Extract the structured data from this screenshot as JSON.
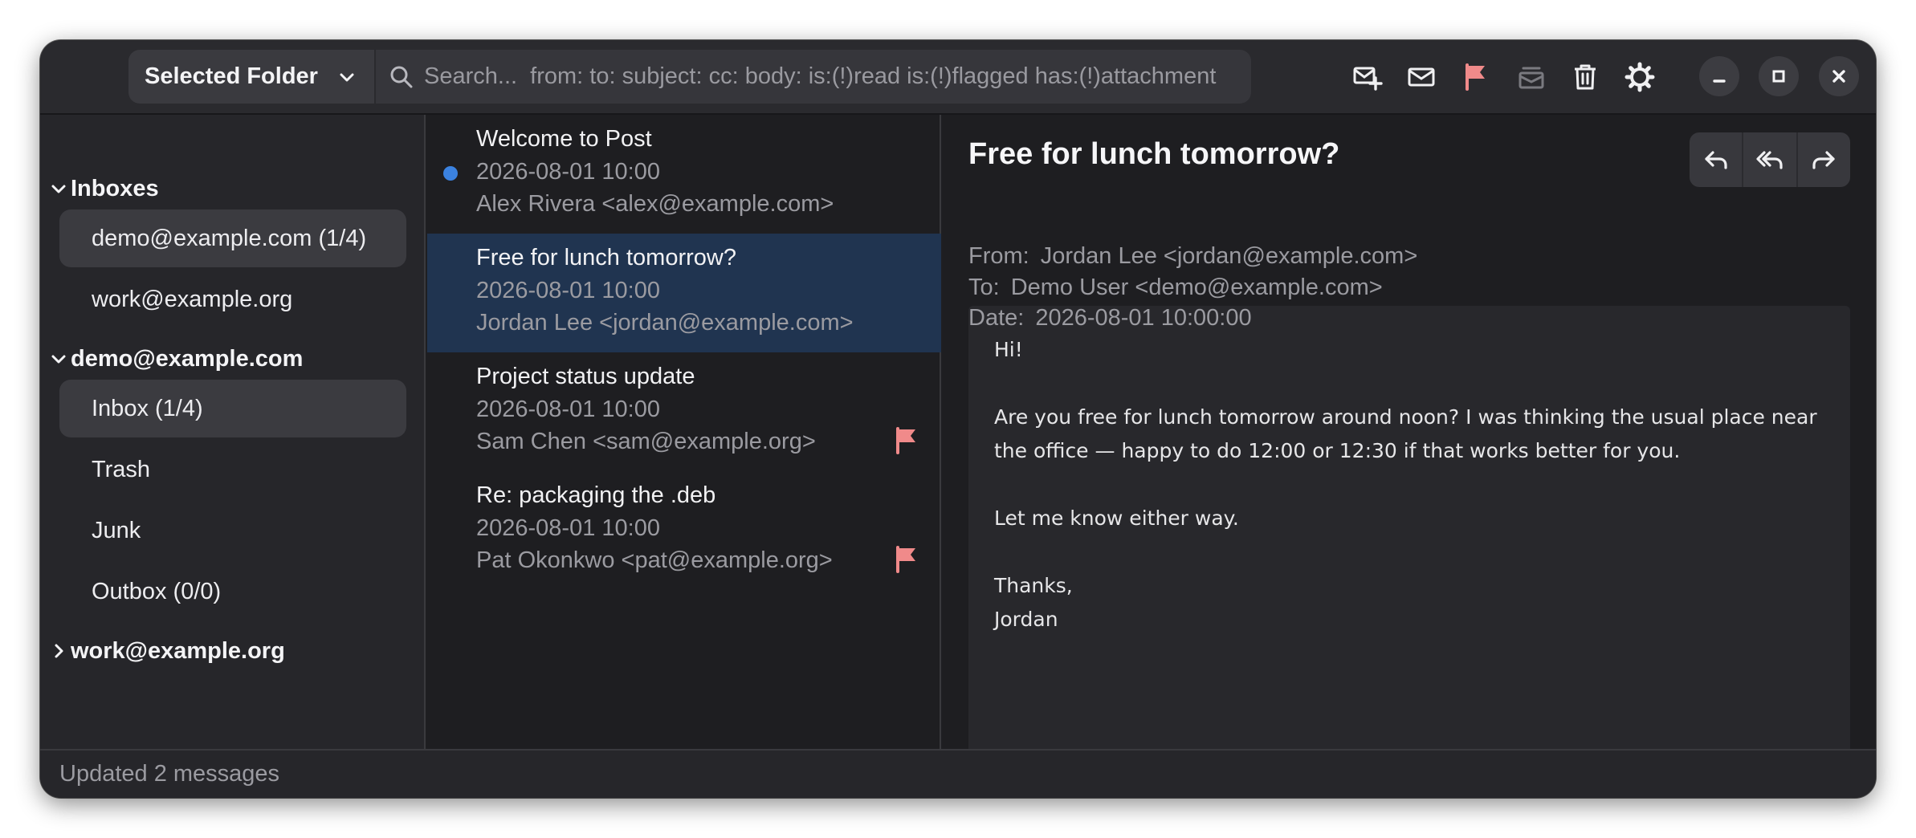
{
  "header": {
    "folder_select_label": "Selected Folder",
    "search_placeholder": "Search...  from: to: subject: cc: body: is:(!)read is:(!)flagged has:(!)attachment"
  },
  "sidebar": {
    "groups": [
      {
        "title": "Inboxes",
        "expanded": true,
        "items": [
          "demo@example.com (1/4)",
          "work@example.org"
        ]
      },
      {
        "title": "demo@example.com",
        "expanded": true,
        "items": [
          "Inbox (1/4)",
          "Trash",
          "Junk",
          "Outbox (0/0)"
        ]
      },
      {
        "title": "work@example.org",
        "expanded": false,
        "items": []
      }
    ]
  },
  "messages": [
    {
      "subject": "Welcome to Post",
      "date": "2026-08-01 10:00",
      "from": "Alex Rivera <alex@example.com>",
      "unread": true,
      "flagged": false,
      "selected": false
    },
    {
      "subject": "Free for lunch tomorrow?",
      "date": "2026-08-01 10:00",
      "from": "Jordan Lee <jordan@example.com>",
      "unread": false,
      "flagged": false,
      "selected": true
    },
    {
      "subject": "Project status update",
      "date": "2026-08-01 10:00",
      "from": "Sam Chen <sam@example.org>",
      "unread": false,
      "flagged": true,
      "selected": false
    },
    {
      "subject": "Re: packaging the .deb",
      "date": "2026-08-01 10:00",
      "from": "Pat Okonkwo <pat@example.org>",
      "unread": false,
      "flagged": true,
      "selected": false
    }
  ],
  "reader": {
    "title": "Free for lunch tomorrow?",
    "from_key": "From:",
    "from_val": "Jordan Lee <jordan@example.com>",
    "to_key": "To:",
    "to_val": "Demo User <demo@example.com>",
    "date_key": "Date:",
    "date_val": "2026-08-01 10:00:00",
    "body": [
      "Hi!",
      "Are you free for lunch tomorrow around noon? I was thinking the usual place near\nthe office — happy to do 12:00 or 12:30 if that works better for you.",
      "Let me know either way.",
      "Thanks,\nJordan"
    ]
  },
  "status": "Updated 2 messages",
  "colors": {
    "accent_selected": "#203450",
    "unread_dot": "#3b82e0",
    "flag": "#f08a8a"
  }
}
